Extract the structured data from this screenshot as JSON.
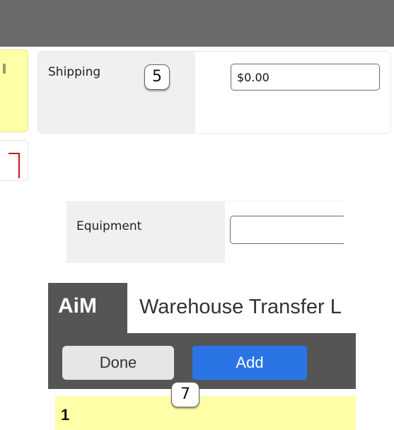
{
  "shipping": {
    "label": "Shipping",
    "value": "$0.00",
    "callout": "5"
  },
  "equipment": {
    "label": "Equipment",
    "value": ""
  },
  "aim": {
    "logo": "AiM",
    "title": "Warehouse Transfer L",
    "done_label": "Done",
    "add_label": "Add",
    "callout": "7",
    "row_number": "1"
  },
  "colors": {
    "top_bar": "#6a6a6a",
    "yellow_highlight": "#ffffa8",
    "add_button": "#2b74e6",
    "header_dark": "#555555"
  }
}
